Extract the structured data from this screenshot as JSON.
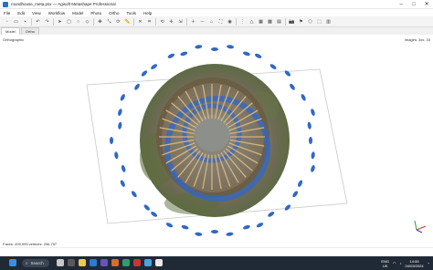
{
  "window": {
    "title": "roundhouse_meta.psx — Agisoft Metashape Professional"
  },
  "menu": [
    "File",
    "Edit",
    "View",
    "Workflow",
    "Model",
    "Photo",
    "Ortho",
    "Tools",
    "Help"
  ],
  "tabs": [
    {
      "label": "Model"
    },
    {
      "label": "Ortho"
    }
  ],
  "viewport": {
    "label_left": "Orthographic",
    "label_right": "Images: 3xx, 33",
    "status_left": "Faces: 499,999  vertices: 256,757"
  },
  "taskbar": {
    "search_placeholder": "Search",
    "lang": "ENG",
    "region": "UK",
    "time": "14:55",
    "date": "04/03/2024"
  }
}
